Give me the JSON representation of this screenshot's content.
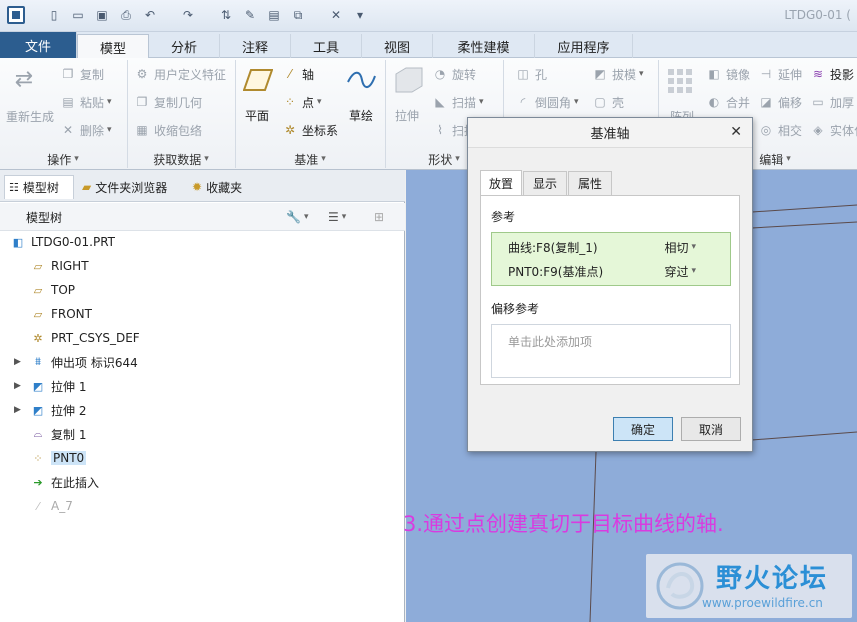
{
  "window": {
    "title": "LTDG0-01 ("
  },
  "quick_access": [
    "new-icon",
    "open-icon",
    "save-icon",
    "print-icon",
    "undo-icon",
    "redo-icon",
    "regenerate-icon",
    "close-window-icon"
  ],
  "tabs": [
    {
      "label": "文件"
    },
    {
      "label": "模型"
    },
    {
      "label": "分析"
    },
    {
      "label": "注释"
    },
    {
      "label": "工具"
    },
    {
      "label": "视图"
    },
    {
      "label": "柔性建模"
    },
    {
      "label": "应用程序"
    }
  ],
  "ribbon": {
    "operations": {
      "label": "操作",
      "regenerate": "重新生成",
      "copy": "复制",
      "paste": "粘贴",
      "delete": "删除"
    },
    "get_data": {
      "label": "获取数据",
      "udf": "用户定义特征",
      "copy_geom": "复制几何",
      "shrinkwrap": "收缩包络"
    },
    "datum": {
      "label": "基准",
      "plane": "平面",
      "axis": "轴",
      "point": "点",
      "csys": "坐标系",
      "sketch": "草绘"
    },
    "shapes": {
      "label": "形状",
      "extrude": "拉伸",
      "revolve": "旋转",
      "sweep": "扫描",
      "sweep2": "扫描"
    },
    "engineering": {
      "hole": "孔",
      "round": "倒圆角",
      "draft": "拔模",
      "shell": "壳"
    },
    "editing": {
      "label": "编辑",
      "pattern": "阵列",
      "mirror": "镜像",
      "extend": "延伸",
      "project": "投影",
      "merge": "合并",
      "offset": "偏移",
      "thicken": "加厚",
      "intersect": "相交",
      "solidify": "实体化"
    }
  },
  "panel": {
    "tabs": {
      "model_tree": "模型树",
      "folder_browser": "文件夹浏览器",
      "favorites": "收藏夹"
    },
    "tree_title": "模型树",
    "items": [
      {
        "label": "LTDG0-01.PRT"
      },
      {
        "label": "RIGHT"
      },
      {
        "label": "TOP"
      },
      {
        "label": "FRONT"
      },
      {
        "label": "PRT_CSYS_DEF"
      },
      {
        "label": "伸出项 标识644"
      },
      {
        "label": "拉伸 1"
      },
      {
        "label": "拉伸 2"
      },
      {
        "label": "复制 1"
      },
      {
        "label": "PNT0"
      },
      {
        "label": "在此插入"
      },
      {
        "label": "A_7"
      }
    ]
  },
  "dialog": {
    "title": "基准轴",
    "tabs": {
      "placement": "放置",
      "display": "显示",
      "properties": "属性"
    },
    "references_label": "参考",
    "references": [
      {
        "name": "曲线:F8(复制_1)",
        "mode": "相切"
      },
      {
        "name": "PNT0:F9(基准点)",
        "mode": "穿过"
      }
    ],
    "offset_label": "偏移参考",
    "offset_placeholder": "单击此处添加项",
    "ok": "确定",
    "cancel": "取消"
  },
  "caption": "3.通过点创建真切于目标曲线的轴.",
  "watermark": {
    "title": "野火论坛",
    "url": "www.proewildfire.cn"
  },
  "colors": {
    "graphics_bg": "#8eacd9",
    "caption": "#d93be0",
    "reference_highlight": "#e5f7d8",
    "file_tab": "#2c5d8f"
  }
}
